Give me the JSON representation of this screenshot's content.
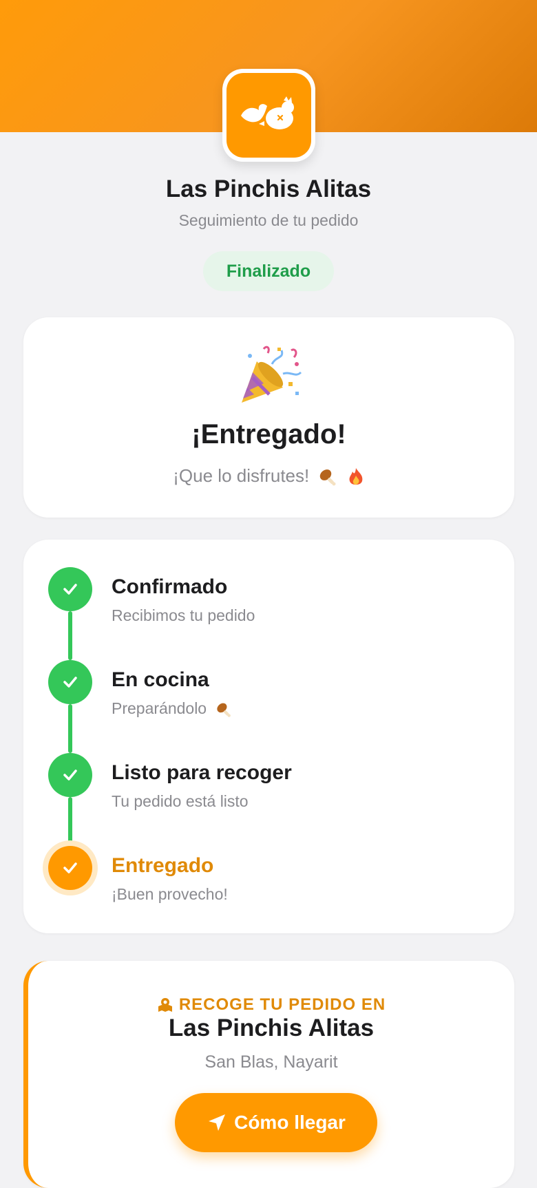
{
  "header": {
    "brand_name": "Las Pinchis Alitas",
    "subtitle": "Seguimiento de tu pedido",
    "status": "Finalizado",
    "logo_icon": "chicken-wings-icon"
  },
  "delivered_card": {
    "emoji_icon": "party-popper-icon",
    "title": "¡Entregado!",
    "message": "¡Que lo disfrutes!"
  },
  "steps": [
    {
      "title": "Confirmado",
      "description": "Recibimos tu pedido",
      "state": "done"
    },
    {
      "title": "En cocina",
      "description": "Preparándolo",
      "state": "done"
    },
    {
      "title": "Listo para recoger",
      "description": "Tu pedido está listo",
      "state": "done"
    },
    {
      "title": "Entregado",
      "description": "¡Buen provecho!",
      "state": "active"
    }
  ],
  "pickup": {
    "label": "RECOGE TU PEDIDO EN",
    "name": "Las Pinchis Alitas",
    "address": "San Blas, Nayarit",
    "button_label": "Cómo llegar"
  },
  "colors": {
    "accent": "#ff9900",
    "success": "#34c759",
    "status_text": "#1f9d4a",
    "active_text": "#e08a08"
  }
}
